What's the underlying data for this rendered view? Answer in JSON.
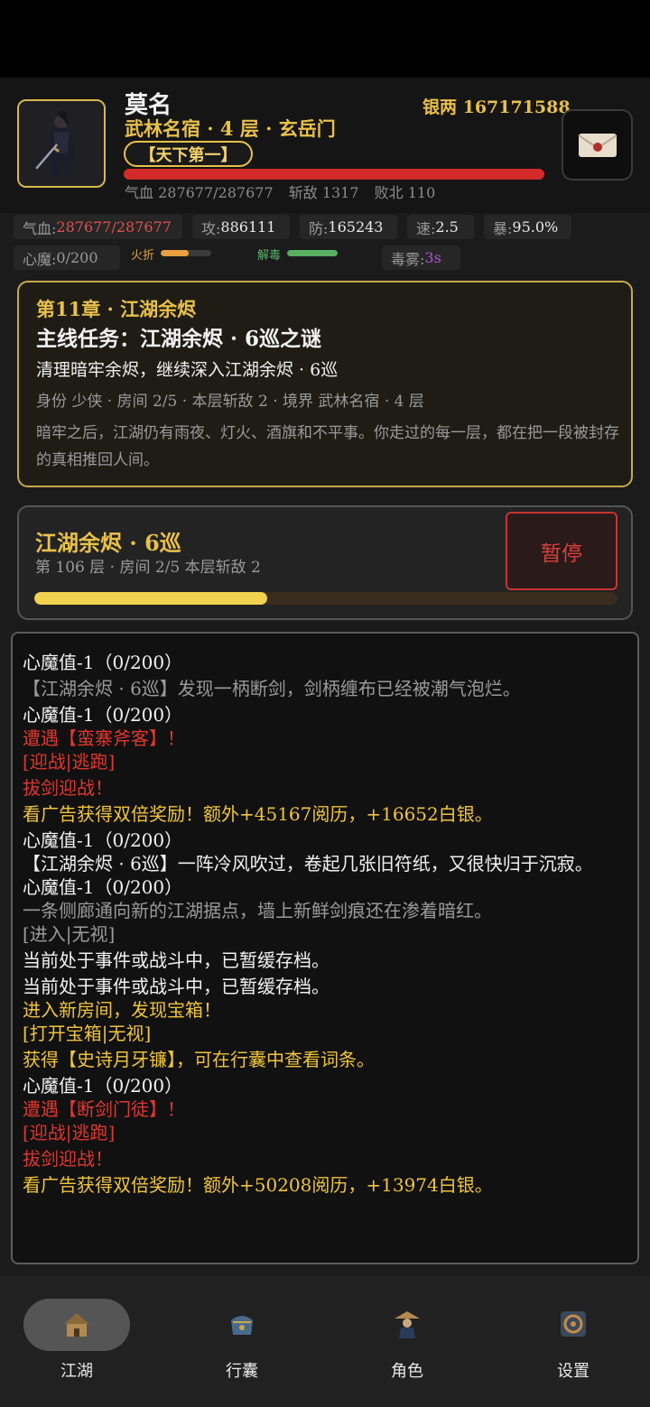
{
  "header": {
    "name": "莫名",
    "silver": "银两 167171588",
    "rank": "武林名宿 · 4 层 · 玄岳门",
    "title_badge": "【天下第一】",
    "qixue": "气血 287677/287677",
    "kills": "斩敌 1317",
    "defeats": "败北 110"
  },
  "stats": {
    "hp_label": "气血:",
    "hp_value": "287677/287677",
    "atk_label": "攻:",
    "atk_value": "886111",
    "def_label": "防:",
    "def_value": "165243",
    "spd_label": "速:",
    "spd_value": "2.5",
    "crit_label": "暴:",
    "crit_value": "95.0%",
    "demon_label": "心魔:",
    "demon_value": "0/200",
    "fire_label": "火折",
    "fire_level": 0.55,
    "detox_label": "解毒",
    "detox_level": 1.0,
    "poison_label": "毒雾:",
    "poison_value": "3s"
  },
  "quest": {
    "chapter": "第11章 · 江湖余烬",
    "title": "主线任务：江湖余烬 · 6巡之谜",
    "goal": "清理暗牢余烬，继续深入江湖余烬 · 6巡",
    "meta": "身份 少侠 · 房间 2/5 · 本层斩敌 2 · 境界 武林名宿 · 4 层",
    "desc": "暗牢之后，江湖仍有雨夜、灯火、酒旗和不平事。你走过的每一层，都在把一段被封存的真相推回人间。"
  },
  "floor": {
    "title": "江湖余烬 · 6巡",
    "meta": "第 106 层 · 房间 2/5   本层斩敌 2",
    "pause_label": "暂停",
    "progress": 0.4
  },
  "log": [
    {
      "text": "心魔值-1（0/200）",
      "style": "w"
    },
    {
      "text": "【江湖余烬 · 6巡】发现一柄断剑，剑柄缠布已经被潮气泡烂。",
      "style": "g"
    },
    {
      "text": "心魔值-1（0/200）",
      "style": "w"
    },
    {
      "text": "遭遇【蛮寨斧客】！",
      "style": "r tight"
    },
    {
      "text": "[迎战|逃跑]",
      "style": "r"
    },
    {
      "text": "拔剑迎战！",
      "style": "r"
    },
    {
      "text": "看广告获得双倍奖励！额外+45167阅历，+16652白银。",
      "style": "y"
    },
    {
      "text": "心魔值-1（0/200）",
      "style": "w"
    },
    {
      "text": "【江湖余烬 · 6巡】一阵冷风吹过，卷起几张旧符纸，又很快归于沉寂。",
      "style": "w tight"
    },
    {
      "text": "心魔值-1（0/200）",
      "style": "w"
    },
    {
      "text": "一条侧廊通向新的江湖据点，墙上新鲜剑痕还在渗着暗红。",
      "style": "g tight"
    },
    {
      "text": "[进入|无视]",
      "style": "g"
    },
    {
      "text": "当前处于事件或战斗中，已暂缓存档。",
      "style": "w"
    },
    {
      "text": "当前处于事件或战斗中，已暂缓存档。",
      "style": "w"
    },
    {
      "text": "进入新房间，发现宝箱！",
      "style": "y tight"
    },
    {
      "text": "[打开宝箱|无视]",
      "style": "y"
    },
    {
      "text": "获得【史诗月牙镰】，可在行囊中查看词条。",
      "style": "y"
    },
    {
      "text": "心魔值-1（0/200）",
      "style": "w"
    },
    {
      "text": "遭遇【断剑门徒】！",
      "style": "r tight"
    },
    {
      "text": "[迎战|逃跑]",
      "style": "r"
    },
    {
      "text": "拔剑迎战！",
      "style": "r"
    },
    {
      "text": "看广告获得双倍奖励！额外+50208阅历，+13974白银。",
      "style": "y"
    }
  ],
  "tabs": [
    {
      "label": "江湖",
      "icon": "town-icon"
    },
    {
      "label": "行囊",
      "icon": "bag-icon"
    },
    {
      "label": "角色",
      "icon": "character-icon"
    },
    {
      "label": "设置",
      "icon": "settings-icon"
    }
  ]
}
